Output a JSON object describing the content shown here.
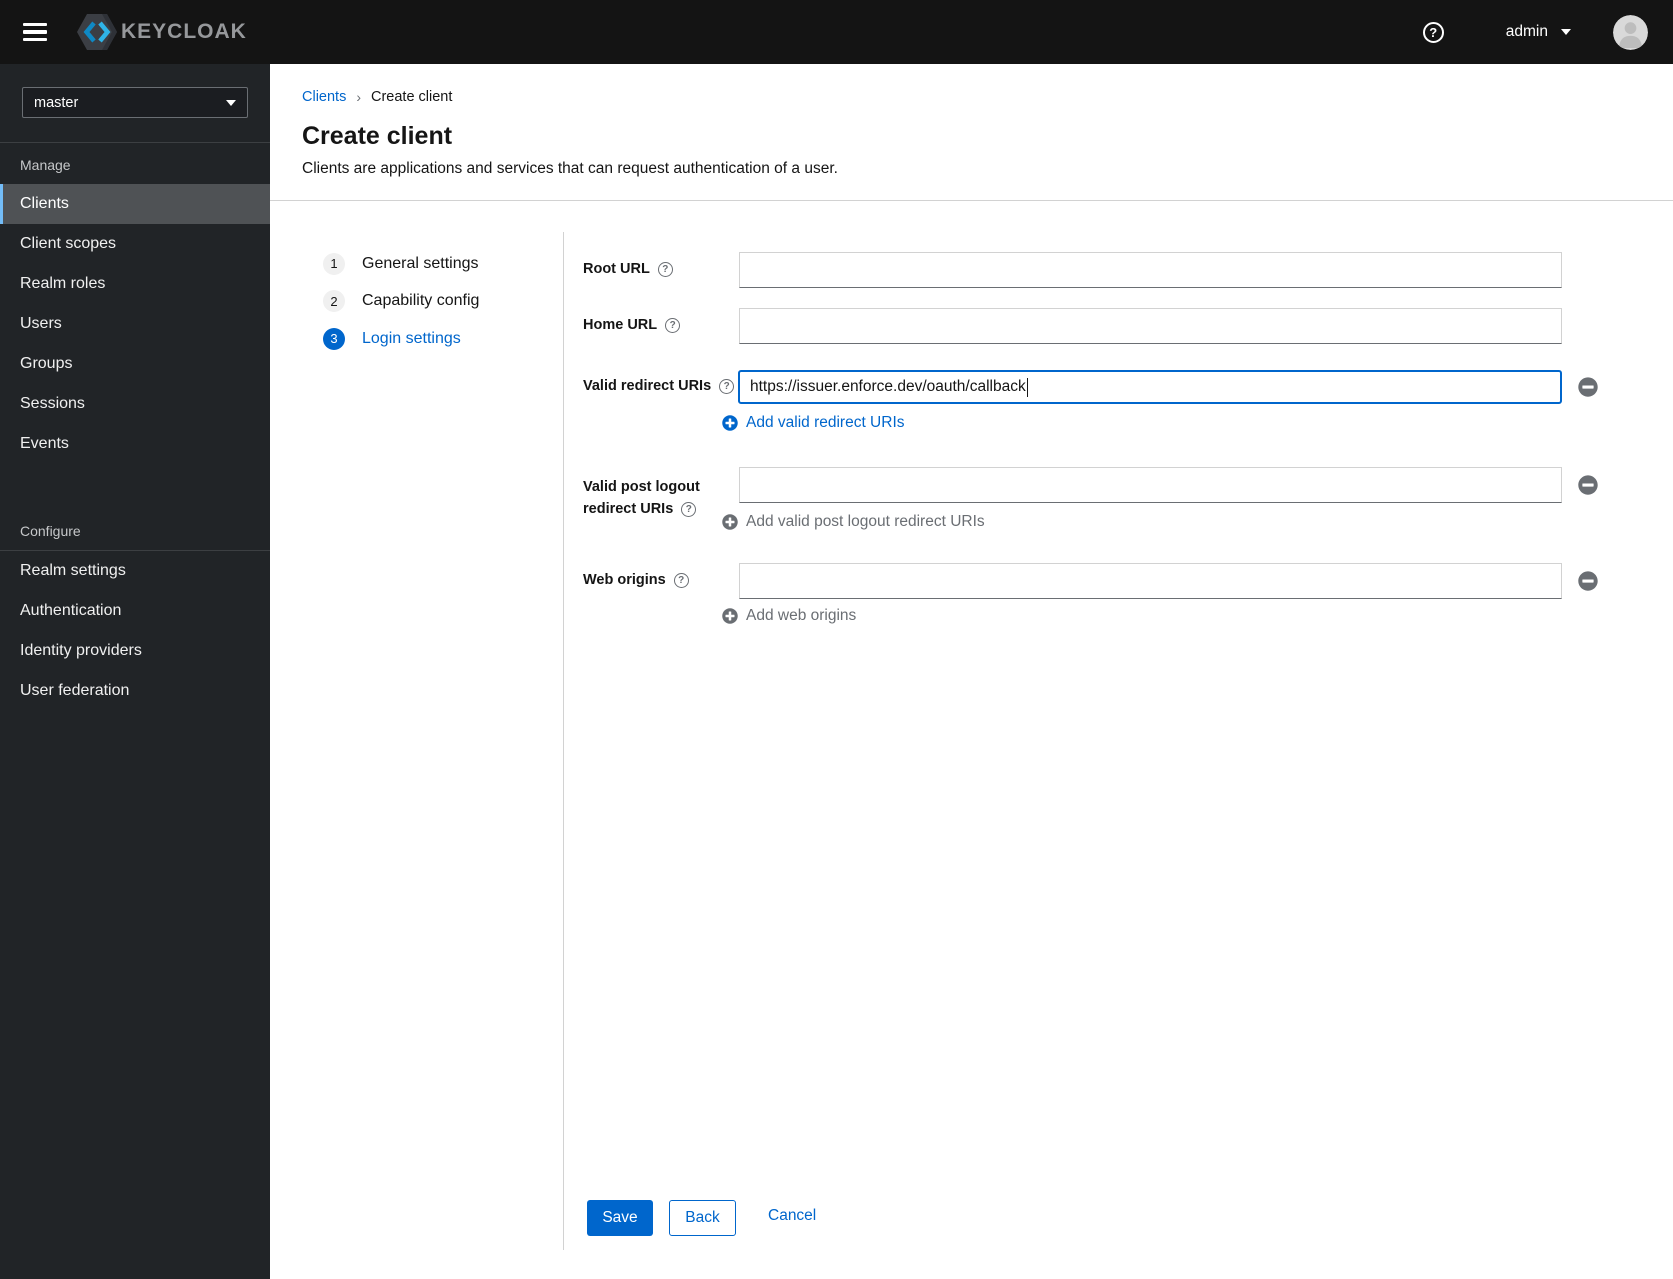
{
  "masthead": {
    "brand": "KEYCLOAK",
    "username": "admin"
  },
  "icons": {
    "question_glyph": "?",
    "help": "question-circle-icon",
    "add": "plus-circle-icon",
    "remove": "minus-circle-icon"
  },
  "sidebar": {
    "realm_selector": {
      "value": "master"
    },
    "groups": [
      {
        "label": "Manage",
        "items": [
          {
            "label": "Clients",
            "active": true
          },
          {
            "label": "Client scopes",
            "active": false
          },
          {
            "label": "Realm roles",
            "active": false
          },
          {
            "label": "Users",
            "active": false
          },
          {
            "label": "Groups",
            "active": false
          },
          {
            "label": "Sessions",
            "active": false
          },
          {
            "label": "Events",
            "active": false
          }
        ]
      },
      {
        "label": "Configure",
        "items": [
          {
            "label": "Realm settings",
            "active": false
          },
          {
            "label": "Authentication",
            "active": false
          },
          {
            "label": "Identity providers",
            "active": false
          },
          {
            "label": "User federation",
            "active": false
          }
        ]
      }
    ]
  },
  "breadcrumb": {
    "link": "Clients",
    "separator": "›",
    "current": "Create client"
  },
  "page_header": {
    "title": "Create client",
    "subtitle": "Clients are applications and services that can request authentication of a user."
  },
  "wizard": {
    "steps": [
      {
        "number": "1",
        "label": "General settings",
        "active": false
      },
      {
        "number": "2",
        "label": "Capability config",
        "active": false
      },
      {
        "number": "3",
        "label": "Login settings",
        "active": true
      }
    ]
  },
  "form": {
    "root_url": {
      "label": "Root URL",
      "value": ""
    },
    "home_url": {
      "label": "Home URL",
      "value": ""
    },
    "valid_redirect_uris": {
      "label": "Valid redirect URIs",
      "value": "https://issuer.enforce.dev/oauth/callback",
      "add_label": "Add valid redirect URIs"
    },
    "valid_post_logout_redirect_uris": {
      "label_line1": "Valid post logout",
      "label_line2": "redirect URIs",
      "value": "",
      "add_label": "Add valid post logout redirect URIs"
    },
    "web_origins": {
      "label": "Web origins",
      "value": "",
      "add_label": "Add web origins"
    }
  },
  "actions": {
    "save": "Save",
    "back": "Back",
    "cancel": "Cancel"
  },
  "colors": {
    "accent": "#0066cc",
    "nav_active_indicator": "#73bcf7",
    "masthead_bg": "#141414",
    "sidebar_bg": "#212427",
    "muted_text": "#6a6e73",
    "divider": "#d2d2d2"
  }
}
